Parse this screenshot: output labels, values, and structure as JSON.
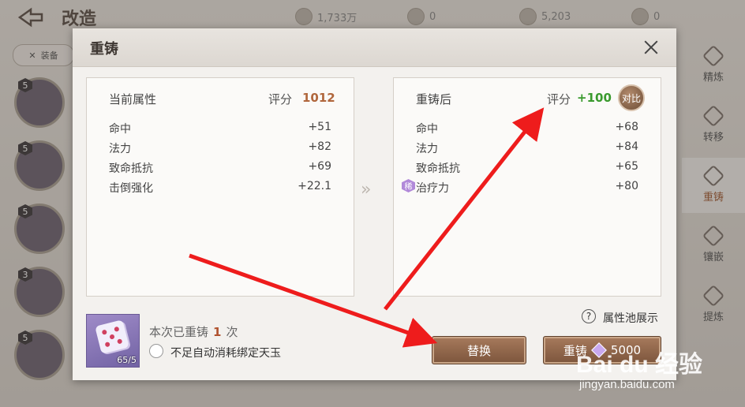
{
  "screen": {
    "title": "改造",
    "currencies": [
      {
        "icon": "gold-icon",
        "value": "1,733万"
      },
      {
        "icon": "silver-icon",
        "value": "0"
      },
      {
        "icon": "jade-icon",
        "value": "5,203"
      },
      {
        "icon": "token-icon",
        "value": "0"
      }
    ],
    "equip_filter": "装备",
    "slots": [
      {
        "level": "5",
        "icon": "helmet-icon"
      },
      {
        "level": "5",
        "icon": "armor-icon"
      },
      {
        "level": "5",
        "icon": "pants-icon"
      },
      {
        "level": "3",
        "icon": "boots-icon"
      },
      {
        "level": "5",
        "icon": "weapon-icon"
      }
    ],
    "side_menu": [
      {
        "label": "精炼",
        "active": false
      },
      {
        "label": "转移",
        "active": false
      },
      {
        "label": "重铸",
        "active": true
      },
      {
        "label": "镶嵌",
        "active": false
      },
      {
        "label": "提炼",
        "active": false
      }
    ]
  },
  "modal": {
    "title": "重铸",
    "current": {
      "heading": "当前属性",
      "score_label": "评分",
      "score": "1012",
      "attributes": [
        {
          "name": "命中",
          "value": "+51"
        },
        {
          "name": "法力",
          "value": "+82"
        },
        {
          "name": "致命抵抗",
          "value": "+69"
        },
        {
          "name": "击倒强化",
          "value": "+22.1"
        }
      ]
    },
    "after": {
      "heading": "重铸后",
      "score_label": "评分",
      "score_delta": "+100",
      "compare_label": "对比",
      "attributes": [
        {
          "name": "命中",
          "value": "+68",
          "special": false
        },
        {
          "name": "法力",
          "value": "+84",
          "special": false
        },
        {
          "name": "致命抵抗",
          "value": "+65",
          "special": false
        },
        {
          "name": "治疗力",
          "value": "+80",
          "special": true,
          "tag": "稀"
        }
      ]
    },
    "footer": {
      "dice_count": "65/5",
      "recast_prefix": "本次已重铸",
      "recast_times": "1",
      "recast_suffix": "次",
      "auto_consume_label": "不足自动消耗绑定天玉",
      "help_symbol": "?",
      "pool_label": "属性池展示",
      "replace_label": "替换",
      "recast_label": "重铸",
      "recast_cost": "5000"
    }
  },
  "watermark": {
    "logo": "Bai du 经验",
    "url": "jingyan.baidu.com"
  },
  "colors": {
    "score_current": "#b0663c",
    "score_delta": "#3a9a2e",
    "annotation_arrow": "#ee1c1c",
    "button_brown": "#8d634a"
  }
}
